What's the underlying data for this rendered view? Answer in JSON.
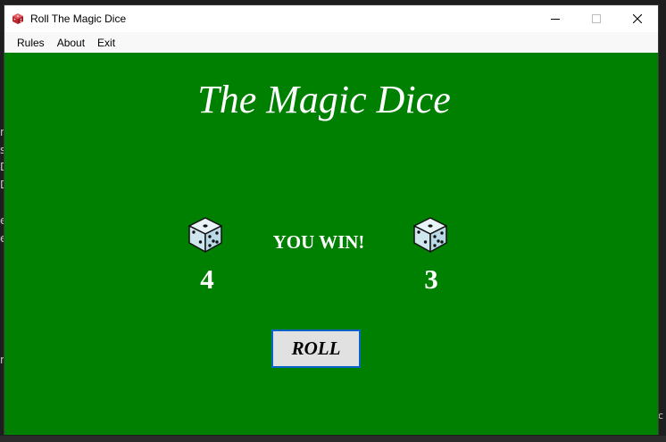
{
  "window": {
    "title": "Roll The Magic Dice",
    "controls": [
      "minimize",
      "maximize",
      "close"
    ]
  },
  "menu": {
    "items": [
      "Rules",
      "About",
      "Exit"
    ]
  },
  "game": {
    "title": "The Magic Dice",
    "result": "YOU WIN!",
    "die_left_value": "4",
    "die_right_value": "3",
    "roll_label": "ROLL"
  },
  "background": {
    "left_fragments": [
      "n",
      "s",
      "D",
      "D",
      "e",
      "e",
      "n"
    ],
    "right_fragment": "c"
  },
  "colors": {
    "table": "#008000",
    "text": "#ffffff",
    "button_bg": "#e1e1e1",
    "button_border": "#0a64c8",
    "die_face": "#cfe6ef",
    "app_icon": "#d0343a"
  }
}
